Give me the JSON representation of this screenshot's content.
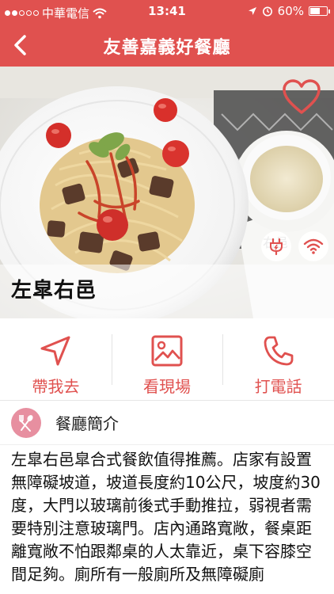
{
  "status_bar": {
    "carrier": "中華電信",
    "time": "13:41",
    "battery_percent": "60%",
    "battery_level": 0.6,
    "signal_bars": 2
  },
  "nav": {
    "title": "友善嘉義好餐廳",
    "back_icon": "chevron-left-icon"
  },
  "hero": {
    "restaurant_name": "左皐右邑",
    "favorite_icon": "heart-outline-icon",
    "amenities": [
      "power-plug-icon",
      "wifi-icon"
    ]
  },
  "actions": [
    {
      "label": "帶我去",
      "icon": "navigation-arrow-icon"
    },
    {
      "label": "看現場",
      "icon": "image-icon"
    },
    {
      "label": "打電話",
      "icon": "phone-icon"
    }
  ],
  "intro": {
    "title": "餐廳簡介",
    "icon": "fork-spoon-icon",
    "body": "左皐右邑皐合式餐飲值得推薦。店家有設置無障礙坡道，坡道長度約10公尺，坡度約30度，大門以玻璃前後式手動推拉，弱視者需要特別注意玻璃門。店內通路寬敞，餐桌距離寬敞不怕跟鄰桌的人太靠近，桌下容膝空間足夠。廁所有一般廁所及無障礙廁"
  },
  "colors": {
    "primary": "#e0514f",
    "intro_icon_bg": "#e78fa0"
  }
}
